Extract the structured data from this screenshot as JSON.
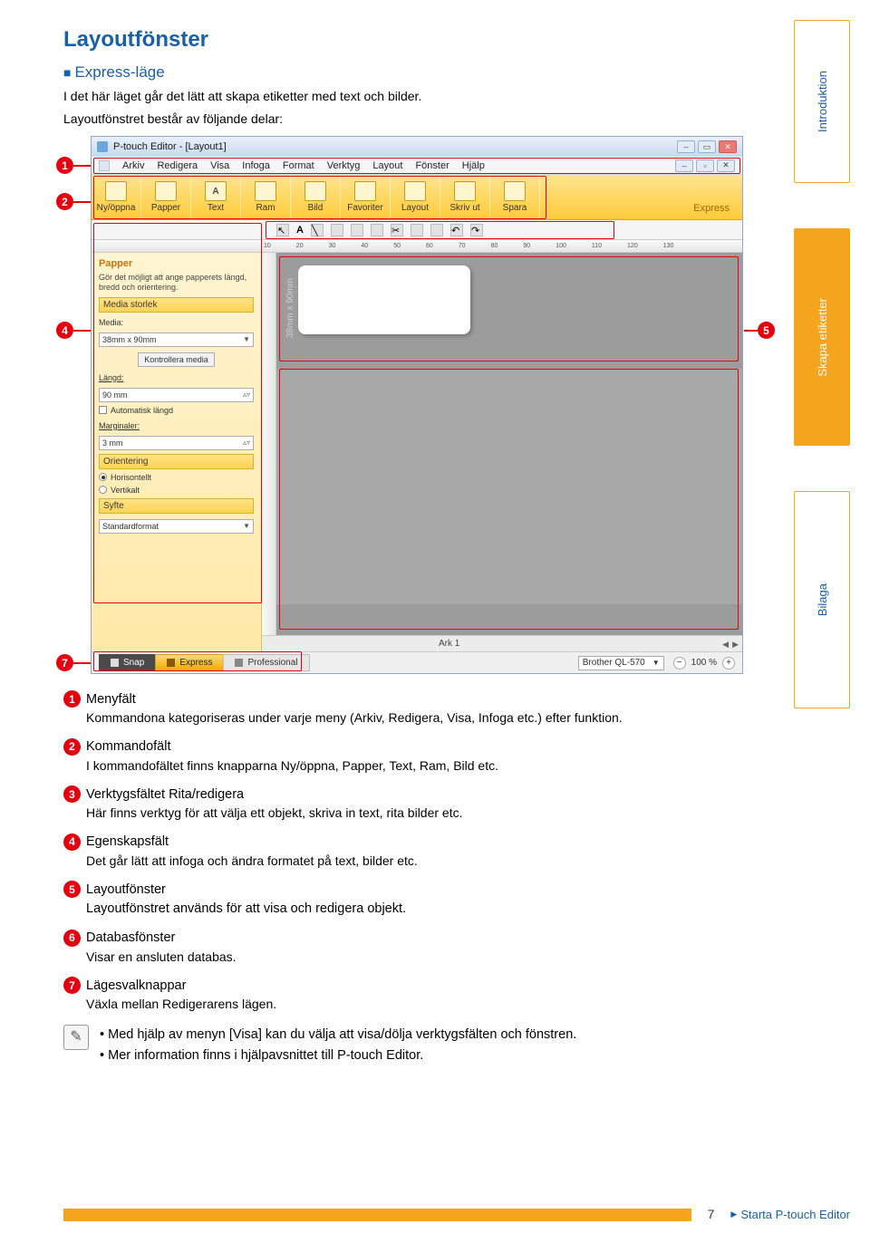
{
  "page_title": "Layoutfönster",
  "mode_heading": "Express-läge",
  "intro_line1": "I det här läget går det lätt att skapa etiketter med text och bilder.",
  "intro_line2": "Layoutfönstret består av följande delar:",
  "side_tabs": {
    "intro": "Introduktion",
    "create": "Skapa etiketter",
    "appendix": "Bilaga"
  },
  "titlebar": "P-touch Editor - [Layout1]",
  "menubar": [
    "Arkiv",
    "Redigera",
    "Visa",
    "Infoga",
    "Format",
    "Verktyg",
    "Layout",
    "Fönster",
    "Hjälp"
  ],
  "cmdbar": {
    "items": [
      "Ny/öppna",
      "Papper",
      "Text",
      "Ram",
      "Bild",
      "Favoriter",
      "Layout",
      "Skriv ut",
      "Spara"
    ],
    "mode_label": "Express"
  },
  "toolbar3_font": "A",
  "ruler_ticks": [
    "10",
    "20",
    "30",
    "40",
    "50",
    "60",
    "70",
    "80",
    "90",
    "100",
    "110",
    "120",
    "130"
  ],
  "props": {
    "title": "Papper",
    "hint": "Gör det möjligt att ange papperets längd, bredd och orientering.",
    "acc_media": "Media storlek",
    "media_label": "Media:",
    "media_value": "38mm x 90mm",
    "check_media_btn": "Kontrollera media",
    "length_label": "Längd:",
    "length_value": "90 mm",
    "auto_len": "Automatisk längd",
    "margins_label": "Marginaler:",
    "margins_value": "3 mm",
    "acc_orient": "Orientering",
    "orient_h": "Horisontellt",
    "orient_v": "Vertikalt",
    "acc_purpose": "Syfte",
    "purpose_value": "Standardformat"
  },
  "label_dim": "38mm x 90mm",
  "ark_tab": "Ark 1",
  "modes": {
    "snap": "Snap",
    "express": "Express",
    "pro": "Professional"
  },
  "printer": "Brother QL-570",
  "zoom": "100 %",
  "legend": [
    {
      "n": "1",
      "title": "Menyfält",
      "desc": "Kommandona kategoriseras under varje meny (Arkiv, Redigera, Visa, Infoga etc.) efter funktion."
    },
    {
      "n": "2",
      "title": "Kommandofält",
      "desc": "I kommandofältet finns knapparna Ny/öppna, Papper, Text, Ram, Bild etc."
    },
    {
      "n": "3",
      "title": "Verktygsfältet Rita/redigera",
      "desc": "Här finns verktyg för att välja ett objekt, skriva in text, rita bilder etc."
    },
    {
      "n": "4",
      "title": "Egenskapsfält",
      "desc": "Det går lätt att infoga och ändra formatet på text, bilder etc."
    },
    {
      "n": "5",
      "title": "Layoutfönster",
      "desc": "Layoutfönstret används för att visa och redigera objekt."
    },
    {
      "n": "6",
      "title": "Databasfönster",
      "desc": "Visar en ansluten databas."
    },
    {
      "n": "7",
      "title": "Lägesvalknappar",
      "desc": "Växla mellan Redigerarens lägen."
    }
  ],
  "notes": [
    "Med hjälp av menyn [Visa] kan du välja att visa/dölja verktygsfälten och fönstren.",
    "Mer information finns i hjälpavsnittet till P-touch Editor."
  ],
  "footer": {
    "page": "7",
    "link": "Starta P-touch Editor"
  }
}
